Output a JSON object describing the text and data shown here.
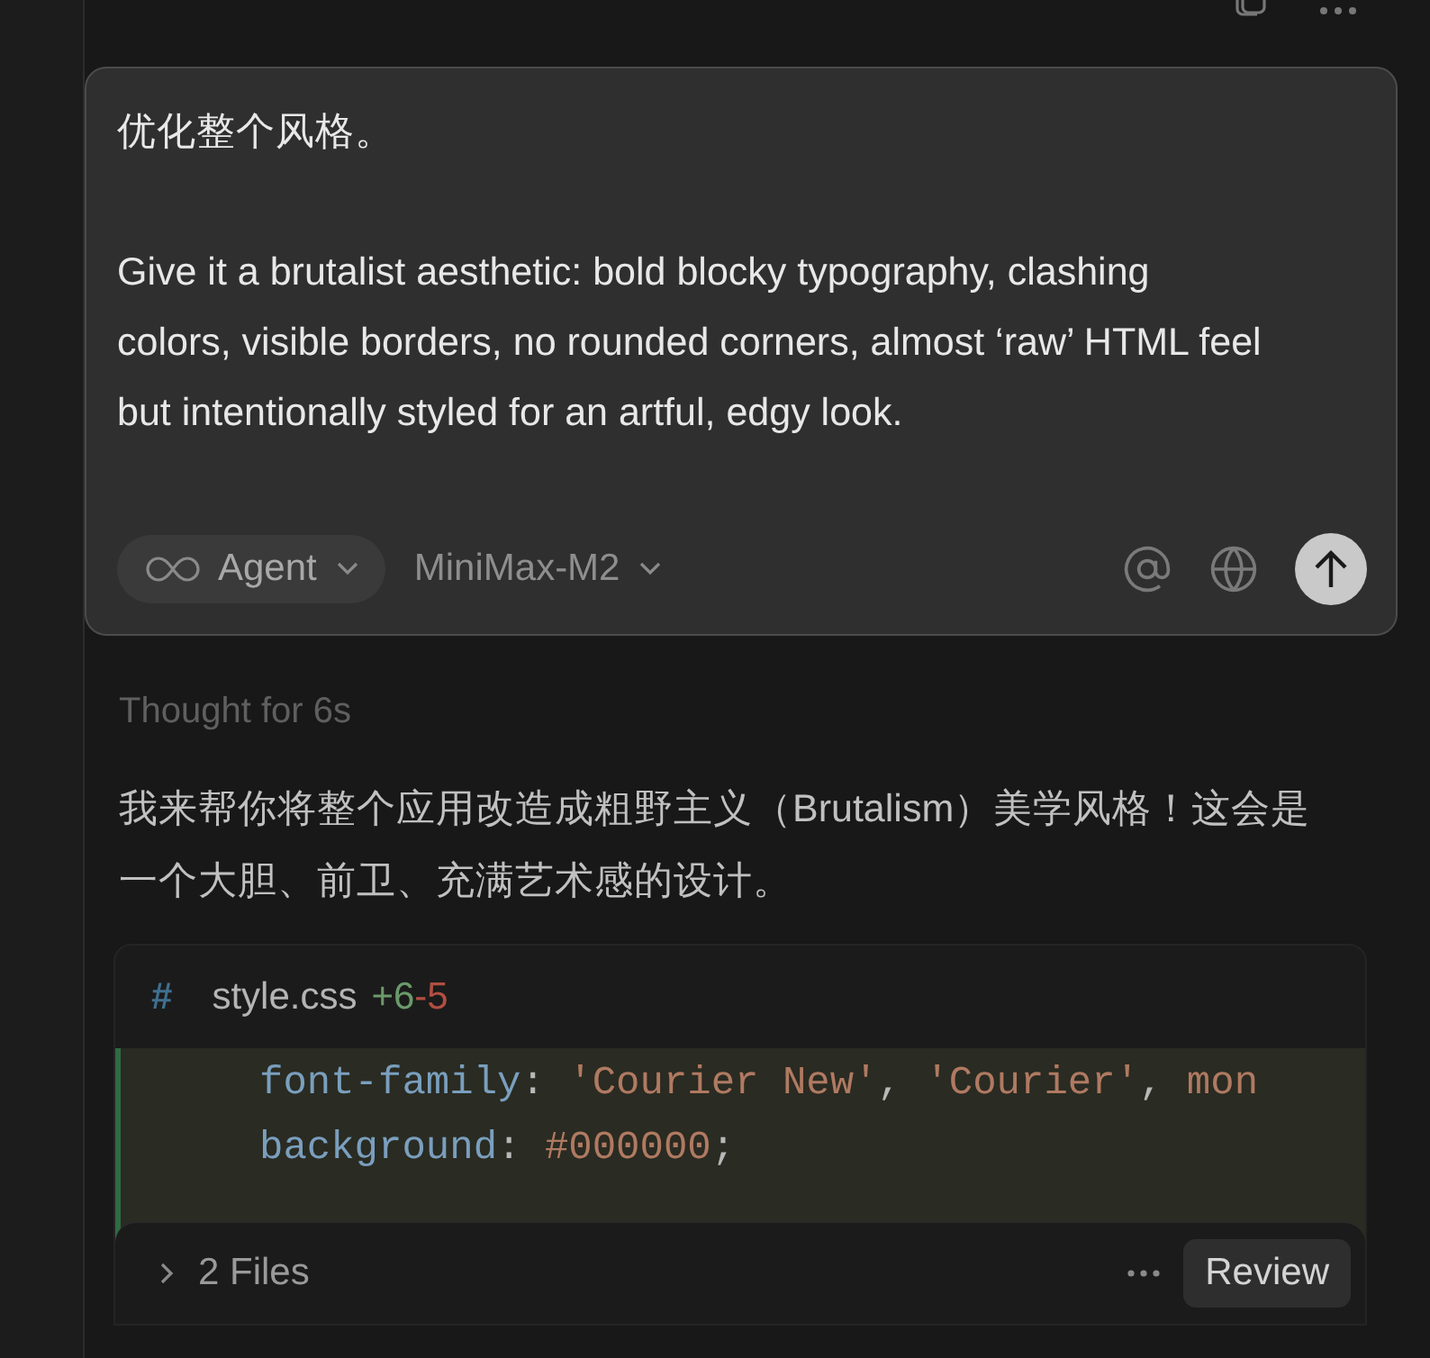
{
  "composer": {
    "paragraphs": [
      "优化整个风格。",
      "Give it a brutalist aesthetic: bold blocky typography, clashing colors, visible borders, no rounded corners, almost ‘raw’ HTML feel but intentionally styled for an artful, edgy look."
    ],
    "mode": "Agent",
    "model": "MiniMax-M2"
  },
  "response": {
    "thought": "Thought for 6s",
    "text": "我来帮你将整个应用改造成粗野主义（Brutalism）美学风格！这会是一个大胆、前卫、充满艺术感的设计。"
  },
  "code_block": {
    "file_mark": "#",
    "filename": "style.css",
    "added": "+6",
    "removed": "-5",
    "lines": [
      [
        {
          "kind": "property",
          "text": "font-family"
        },
        {
          "kind": "punct",
          "text": ": "
        },
        {
          "kind": "value",
          "text": "'Courier New'"
        },
        {
          "kind": "punct",
          "text": ", "
        },
        {
          "kind": "value",
          "text": "'Courier'"
        },
        {
          "kind": "punct",
          "text": ", "
        },
        {
          "kind": "value",
          "text": "mon"
        }
      ],
      [
        {
          "kind": "property",
          "text": "background"
        },
        {
          "kind": "punct",
          "text": ": "
        },
        {
          "kind": "value",
          "text": "#000000"
        },
        {
          "kind": "punct",
          "text": ";"
        }
      ]
    ]
  },
  "files_bar": {
    "label": "2 Files",
    "button": "Review"
  }
}
